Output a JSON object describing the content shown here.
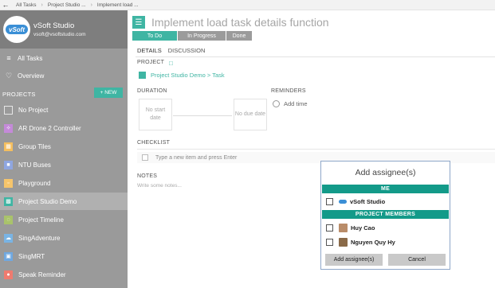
{
  "topbar": {
    "breadcrumbs": [
      "All Tasks",
      "Project Studio ...",
      "Implement load ..."
    ]
  },
  "sidebar": {
    "profile": {
      "name": "vSoft Studio",
      "email": "vsoft@vsoftstudio.com",
      "logo_text": "vSoft"
    },
    "nav": [
      {
        "label": "All Tasks",
        "icon": "list-icon"
      },
      {
        "label": "Overview",
        "icon": "heart-icon"
      }
    ],
    "projects_label": "PROJECTS",
    "new_label": "+ NEW",
    "projects": [
      {
        "label": "No Project",
        "color": ""
      },
      {
        "label": "AR Drone 2 Controller",
        "color": "#c48ad8"
      },
      {
        "label": "Group Tiles",
        "color": "#f4be5f"
      },
      {
        "label": "NTU Buses",
        "color": "#8fa6e0"
      },
      {
        "label": "Playground",
        "color": "#f6c56b"
      },
      {
        "label": "Project Studio Demo",
        "color": "#3fb5a3"
      },
      {
        "label": "Project Timeline",
        "color": "#a9c36b"
      },
      {
        "label": "SingAdventure",
        "color": "#79b4e4"
      },
      {
        "label": "SingMRT",
        "color": "#6fa8e0"
      },
      {
        "label": "Speak Reminder",
        "color": "#ef7b6f"
      }
    ]
  },
  "main": {
    "title": "Implement load task details function",
    "statuses": [
      "To Do",
      "In Progress",
      "Done"
    ],
    "tabs": [
      "DETAILS",
      "DISCUSSION"
    ],
    "project_label": "PROJECT",
    "project_path": "Project Studio Demo > Task",
    "duration_label": "DURATION",
    "start_date": "No start date",
    "due_date": "No due date",
    "reminders_label": "REMINDERS",
    "add_time": "Add time",
    "checklist_label": "CHECKLIST",
    "checklist_placeholder": "Type a new item and press Enter",
    "notes_label": "NOTES",
    "notes_placeholder": "Write some notes..."
  },
  "dialog": {
    "title": "Add assignee(s)",
    "me_label": "ME",
    "me_name": "vSoft Studio",
    "members_label": "PROJECT MEMBERS",
    "members": [
      "Huy Cao",
      "Nguyen Quy Hy"
    ],
    "add_button": "Add assignee(s)",
    "cancel_button": "Cancel"
  }
}
